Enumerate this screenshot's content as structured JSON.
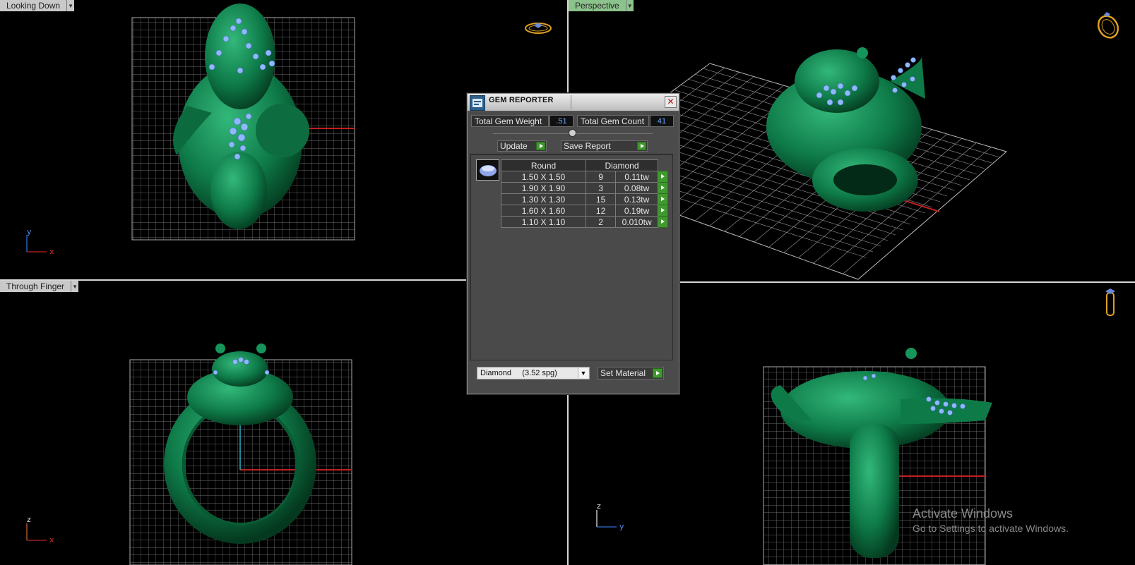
{
  "viewports": {
    "top_left": {
      "label": "Looking Down",
      "axis_v": "y",
      "axis_h": "x"
    },
    "top_right": {
      "label": "Perspective"
    },
    "bottom_left": {
      "label": "Through Finger",
      "axis_v": "z",
      "axis_h": "x"
    },
    "bottom_right": {
      "axis_v": "z",
      "axis_h": "y"
    }
  },
  "gem_reporter": {
    "title": "GEM REPORTER",
    "total_weight_label": "Total Gem Weight",
    "total_weight_value": ".51",
    "total_count_label": "Total Gem Count",
    "total_count_value": "41",
    "update_label": "Update",
    "save_report_label": "Save Report",
    "table_headers": [
      "Round",
      "Diamond"
    ],
    "rows": [
      {
        "size": "1.50 X 1.50",
        "count": "9",
        "weight": "0.11tw"
      },
      {
        "size": "1.90 X 1.90",
        "count": "3",
        "weight": "0.08tw"
      },
      {
        "size": "1.30 X 1.30",
        "count": "15",
        "weight": "0.13tw"
      },
      {
        "size": "1.60 X 1.60",
        "count": "12",
        "weight": "0.19tw"
      },
      {
        "size": "1.10 X 1.10",
        "count": "2",
        "weight": "0.010tw"
      }
    ],
    "material_value": "Diamond     (3.52 spg)",
    "set_material_label": "Set Material"
  },
  "watermark": {
    "line1": "Activate Windows",
    "line2": "Go to Settings to activate Windows."
  },
  "colors": {
    "model_green": "#0f7a4a",
    "gem_blue": "#8fb8ff",
    "grid": "#8a8a8a",
    "active_label": "#8cc28c",
    "go_button": "#3f9a2d"
  },
  "icons": [
    "ring-view-top-icon",
    "ring-view-perspective-icon",
    "ring-view-side-icon",
    "dropdown-arrow-icon",
    "close-icon",
    "go-arrow-icon",
    "gem-thumbnail-icon"
  ]
}
